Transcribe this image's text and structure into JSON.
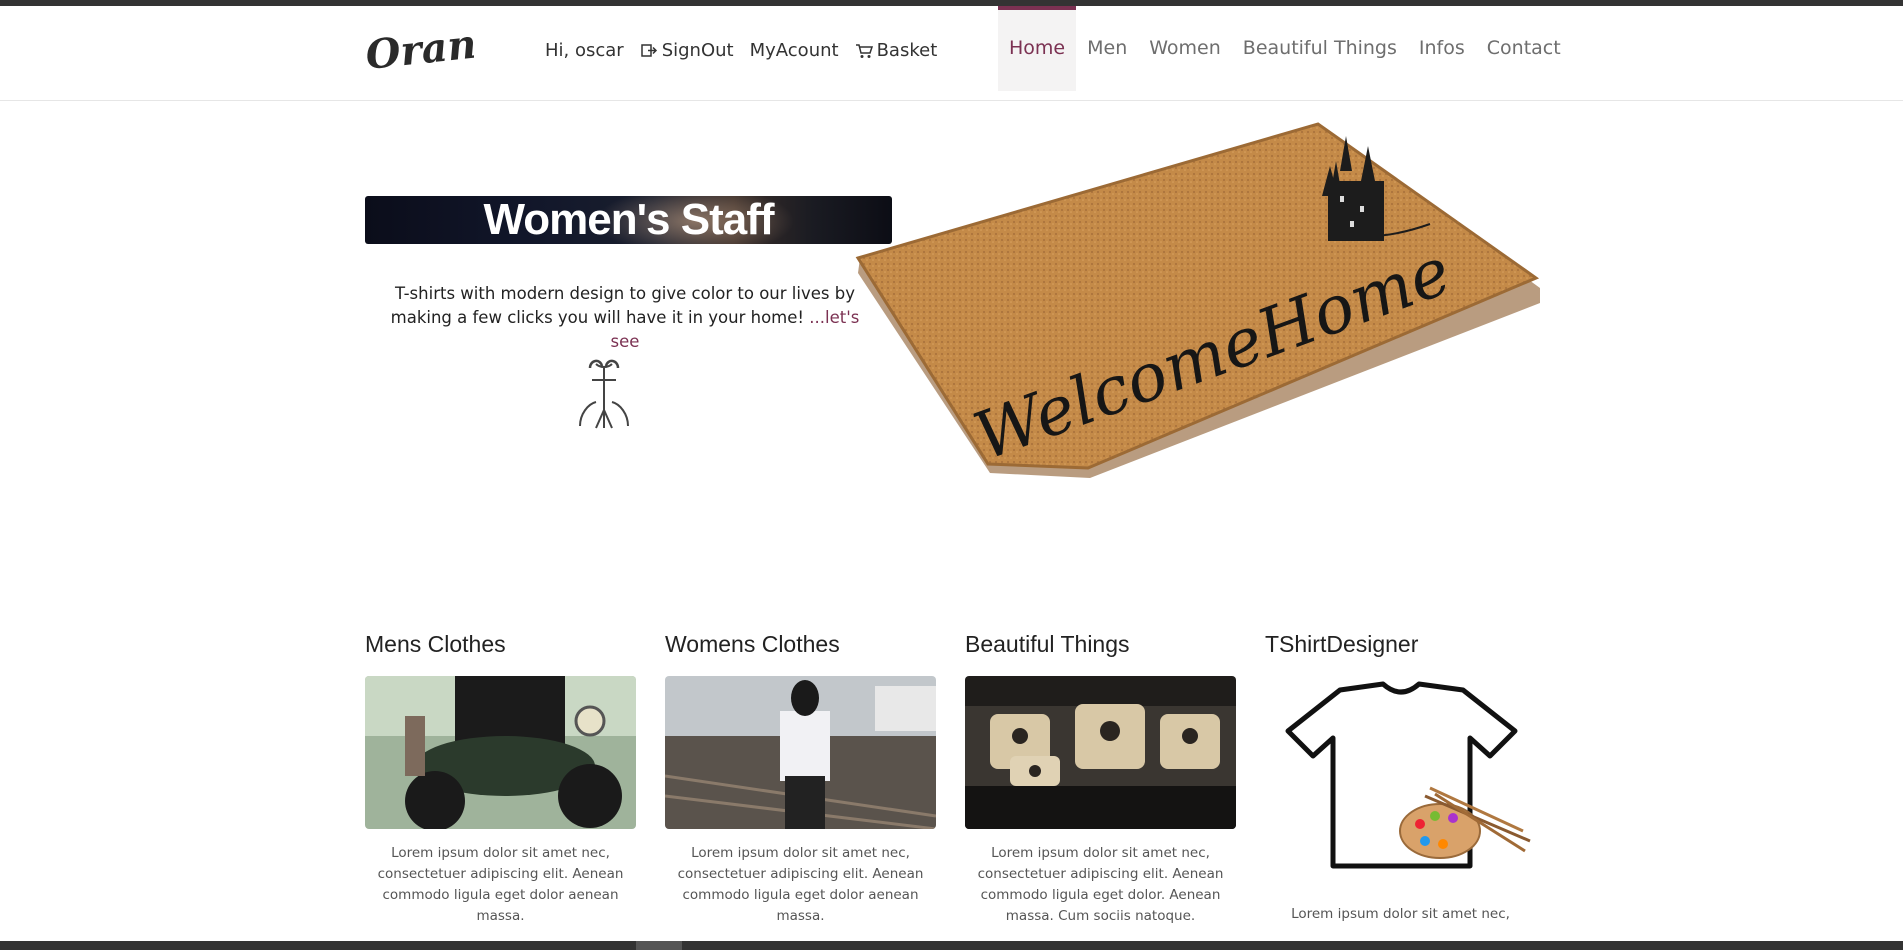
{
  "header": {
    "logo_text": "Orange",
    "user_greeting": "Hi, oscar",
    "signout_label": "SignOut",
    "account_label": "MyAcount",
    "basket_label": "Basket"
  },
  "nav": {
    "items": [
      {
        "label": "Home",
        "active": true
      },
      {
        "label": "Men"
      },
      {
        "label": "Women"
      },
      {
        "label": "Beautiful Things"
      },
      {
        "label": "Infos"
      },
      {
        "label": "Contact"
      }
    ]
  },
  "hero": {
    "banner_title": "Women's Staff",
    "text": "T-shirts with modern design to give color to our lives by making a few clicks you will have it in your home!",
    "link_text": "...let's see",
    "doormat_text": "WelcomeHome"
  },
  "categories": [
    {
      "title": "Mens Clothes",
      "text": "Lorem ipsum dolor sit amet nec, consectetuer adipiscing elit. Aenean commodo ligula eget dolor aenean massa."
    },
    {
      "title": "Womens Clothes",
      "text": "Lorem ipsum dolor sit amet nec, consectetuer adipiscing elit. Aenean commodo ligula eget dolor aenean massa."
    },
    {
      "title": "Beautiful Things",
      "text": "Lorem ipsum dolor sit amet nec, consectetuer adipiscing elit. Aenean commodo ligula eget dolor. Aenean massa. Cum sociis natoque."
    },
    {
      "title": "TShirtDesigner",
      "text": "Lorem ipsum dolor sit amet nec,"
    }
  ],
  "colors": {
    "accent": "#7b3152",
    "nav_text": "#6e6e6e"
  },
  "icons": {
    "signout": "signout-icon",
    "basket": "basket-icon"
  }
}
